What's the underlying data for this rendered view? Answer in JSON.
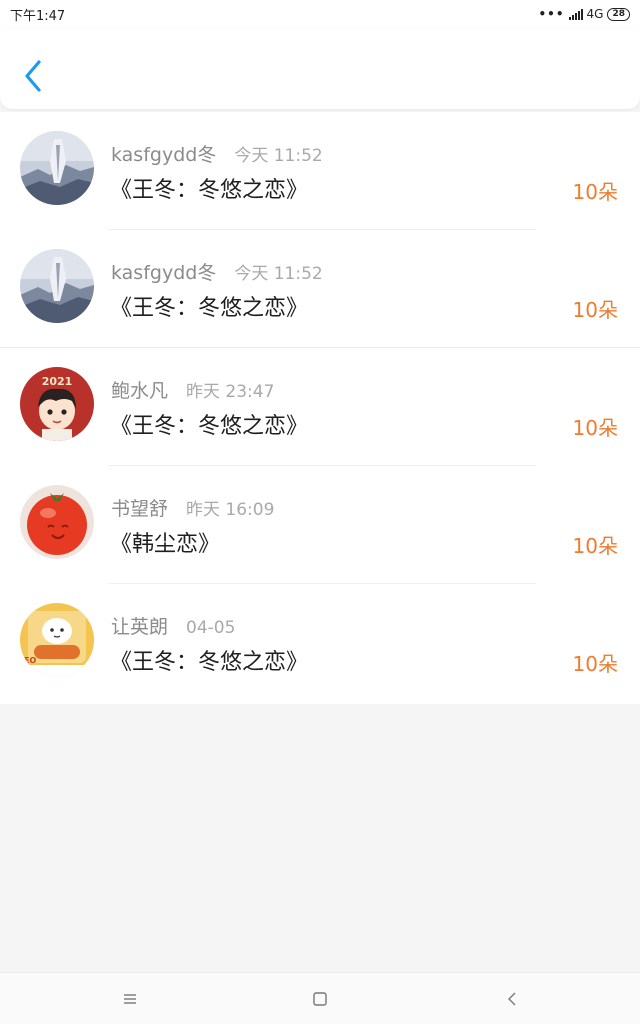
{
  "status_bar": {
    "time": "下午1:47",
    "dots": "•••",
    "network": "4G",
    "battery": "28"
  },
  "header": {
    "back_icon": "chevron-left-icon",
    "accent_color": "#1e9bf0"
  },
  "records": [
    {
      "name": "kasfgydd冬",
      "time": "今天 11:52",
      "book": "《王冬：冬悠之恋》",
      "amount": "10朵",
      "avatar": "anime-scenery-avatar"
    },
    {
      "name": "kasfgydd冬",
      "time": "今天 11:52",
      "book": "《王冬：冬悠之恋》",
      "amount": "10朵",
      "avatar": "anime-scenery-avatar"
    },
    {
      "name": "鲍水凡",
      "time": "昨天 23:47",
      "book": "《王冬：冬悠之恋》",
      "amount": "10朵",
      "avatar": "cartoon-boy-2021-avatar"
    },
    {
      "name": "书望舒",
      "time": "昨天 16:09",
      "book": "《韩尘恋》",
      "amount": "10朵",
      "avatar": "tomato-face-avatar"
    },
    {
      "name": "让英朗",
      "time": "04-05",
      "book": "《王冬：冬悠之恋》",
      "amount": "10朵",
      "avatar": "cartoon-sticker-avatar"
    }
  ],
  "colors": {
    "amount": "#f07a2d",
    "name": "#8b8b8b",
    "time": "#a9a9a9"
  },
  "nav": {
    "menu_icon": "menu-icon",
    "home_icon": "square-home-icon",
    "back_icon": "triangle-back-icon"
  }
}
